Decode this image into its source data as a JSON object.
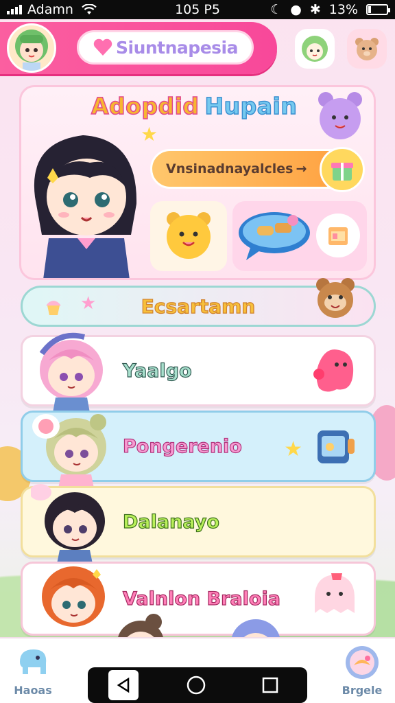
{
  "status_bar": {
    "carrier": "Adamn",
    "time": "105 P5",
    "battery": "13%",
    "battery_level": 0.13
  },
  "header": {
    "app_title": "Siuntnapesia",
    "avatar_icon": "girl-avatar-icon",
    "button1_icon": "green-face-icon",
    "button2_icon": "bear-face-icon"
  },
  "hero": {
    "title_word1": "Adopdid",
    "title_word2": "Hupain",
    "cta_label": "Vnsinadnayalcles",
    "cta_icon": "gift-box-icon",
    "tile_a_icon": "yellow-bear-icon",
    "tile_b_icon": "blue-bubble-icon",
    "tile_b_extra_icon": "game-box-icon"
  },
  "banner": {
    "label": "Ecsartamn"
  },
  "characters": [
    {
      "label": "Yaalgo",
      "deco_icon": "pink-blob-icon"
    },
    {
      "label": "Pongerenio",
      "deco_icon": "toaster-icon"
    },
    {
      "label": "Dalanayo",
      "deco_icon": ""
    },
    {
      "label": "Valnlon Braloia",
      "deco_icon": "pink-ghost-icon"
    }
  ],
  "bottom_nav": {
    "left_label": "Haoas",
    "right_label": "Brgele",
    "left_icon": "elephant-icon",
    "right_icon": "bird-globe-icon"
  },
  "colors": {
    "accent": "#f8489a",
    "banner_border": "#9cd7d3",
    "cta": "#ff9e3d"
  }
}
